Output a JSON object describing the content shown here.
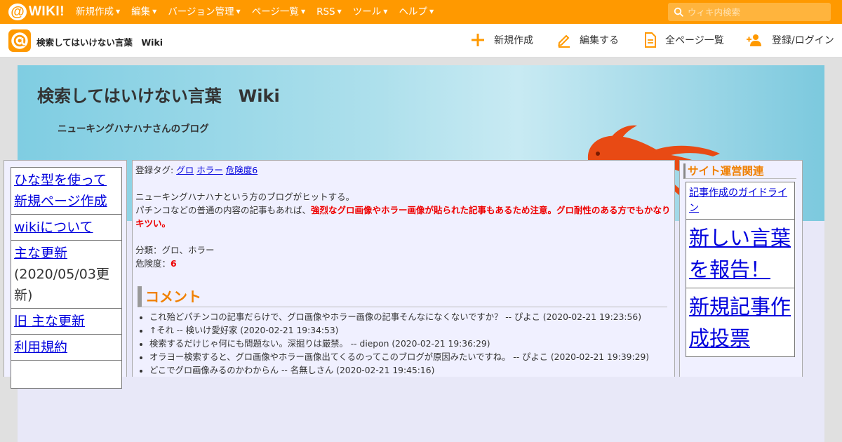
{
  "topbar": {
    "logo_text": "WIKI!",
    "menu": [
      "新規作成",
      "編集",
      "バージョン管理",
      "ページ一覧",
      "RSS",
      "ツール",
      "ヘルプ"
    ],
    "search_placeholder": "ウィキ内検索",
    "color": "#ff9900"
  },
  "subbar": {
    "wiki_name": "検索してはいけない言葉　Wiki",
    "actions": {
      "new": "新規作成",
      "edit": "編集する",
      "all_pages": "全ページ一覧",
      "login": "登録/ログイン"
    }
  },
  "banner": {
    "title": "検索してはいけない言葉　Wiki",
    "description": "ニューキングハナハナさんのブログ"
  },
  "left_menu": {
    "items": [
      {
        "label": "ひな型を使って新規ページ作成"
      },
      {
        "label": "wikiについて"
      },
      {
        "label": "主な更新",
        "note": "(2020/05/03更新)"
      },
      {
        "label": "旧 主な更新"
      },
      {
        "label": "利用規約"
      }
    ]
  },
  "article": {
    "tags_label": "登録タグ:",
    "tags": [
      "グロ",
      "ホラー",
      "危険度6"
    ],
    "intro": "ニューキングハナハナという方のブログがヒットする。",
    "body_plain": "パチンコなどの普通の内容の記事もあれば、",
    "body_warning": "強烈なグロ画像やホラー画像が貼られた記事もあるため注意。グロ耐性のある方でもかなりキツい。",
    "category_line": "分類：グロ、ホラー",
    "danger_label": "危険度：",
    "danger_value": "6"
  },
  "comments": {
    "heading": "コメント",
    "items": [
      "これ殆どパチンコの記事だらけで、グロ画像やホラー画像の記事そんなになくないですか？ -- ぴよこ (2020-02-21 19:23:56)",
      "↑それ -- 検いけ愛好家 (2020-02-21 19:34:53)",
      "検索するだけじゃ何にも問題ない。深掘りは厳禁。 -- diepon (2020-02-21 19:36:29)",
      "オラヨー検索すると、グロ画像やホラー画像出てくるのってこのブログが原因みたいですね。 -- ぴよこ (2020-02-21 19:39:29)",
      "どこでグロ画像みるのかわからん -- 名無しさん (2020-02-21 19:45:16)"
    ]
  },
  "right_menu": {
    "heading": "サイト運営関連",
    "items": [
      "記事作成のガイドライン",
      "新しい言葉を報告！",
      "新規記事作成投票"
    ]
  },
  "colors": {
    "accent_orange": "#ff9900",
    "heading_orange": "#f08000",
    "link_blue": "#0000dd",
    "warning_red": "#ee0000",
    "fish": "#e84a14"
  }
}
